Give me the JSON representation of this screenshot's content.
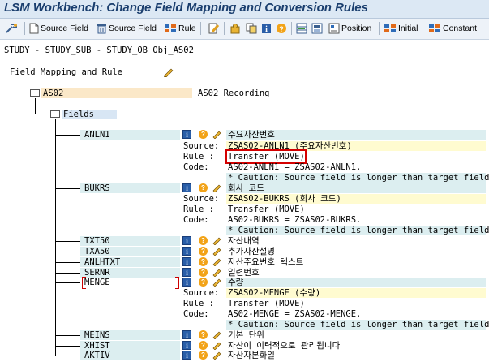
{
  "window": {
    "title": "LSM Workbench: Change Field Mapping and Conversion Rules"
  },
  "toolbar": {
    "source_field": "Source Field",
    "source_field2": "Source Field",
    "rule": "Rule",
    "position": "Position",
    "initial": "Initial",
    "constant": "Constant"
  },
  "breadcrumb": "STUDY - STUDY_SUB - STUDY_OB Obj_AS02",
  "tree": {
    "root_label": "Field Mapping and Rule",
    "node_as02": "AS02",
    "node_as02_desc": "AS02 Recording",
    "node_fields": "Fields",
    "labels": {
      "source": "Source:",
      "rule": "Rule :",
      "code": "Code:"
    },
    "fields": [
      {
        "name": "ANLN1",
        "desc": "주요자산번호",
        "source": "ZSAS02-ANLN1 (주요자산번호)",
        "rule": "Transfer (MOVE)",
        "code": "AS02-ANLN1 = ZSAS02-ANLN1.",
        "caution": "* Caution: Source field is longer than target field"
      },
      {
        "name": "BUKRS",
        "desc": "회사 코드",
        "source": "ZSAS02-BUKRS (회사 코드)",
        "rule": "Transfer (MOVE)",
        "code": "AS02-BUKRS = ZSAS02-BUKRS.",
        "caution": "* Caution: Source field is longer than target field"
      },
      {
        "name": "TXT50",
        "desc": "자산내역"
      },
      {
        "name": "TXA50",
        "desc": "추가자산설명"
      },
      {
        "name": "ANLHTXT",
        "desc": "자산주요번호 텍스트"
      },
      {
        "name": "SERNR",
        "desc": "일련번호"
      },
      {
        "name": "MENGE",
        "desc": "수량",
        "source": "ZSAS02-MENGE (수량)",
        "rule": "Transfer (MOVE)",
        "code": "AS02-MENGE = ZSAS02-MENGE.",
        "caution": "* Caution: Source field is longer than target field"
      },
      {
        "name": "MEINS",
        "desc": "기본 단위"
      },
      {
        "name": "XHIST",
        "desc": "자산이 이력적으로 관리됩니다"
      },
      {
        "name": "AKTIV",
        "desc": "자산자본화일"
      }
    ]
  }
}
